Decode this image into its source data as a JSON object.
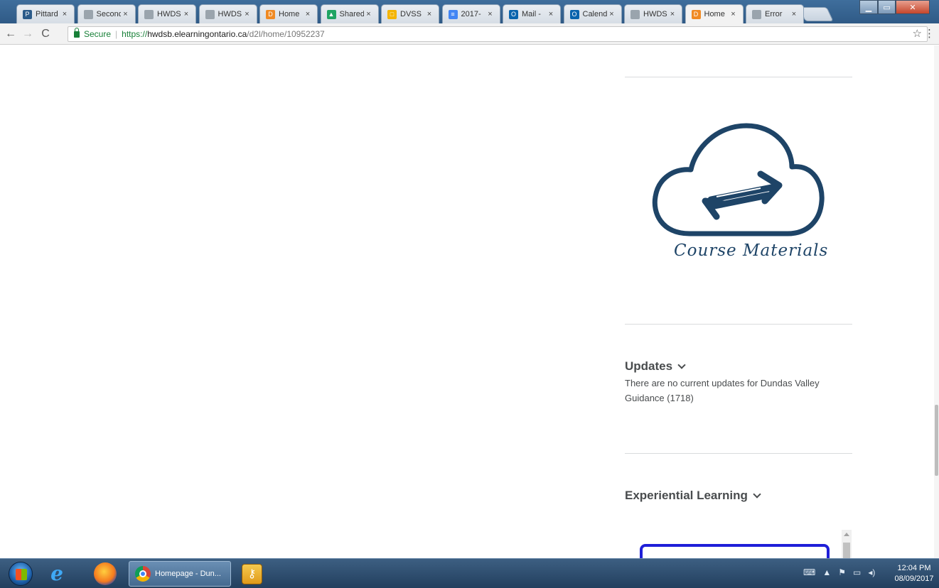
{
  "browser": {
    "tabs": [
      {
        "title": "Pittard",
        "favicon_color": "#2b5b8a",
        "favicon_char": "P"
      },
      {
        "title": "Second",
        "favicon_color": "#9aa4ad",
        "favicon_char": ""
      },
      {
        "title": "HWDS",
        "favicon_color": "#9aa4ad",
        "favicon_char": ""
      },
      {
        "title": "HWDS",
        "favicon_color": "#9aa4ad",
        "favicon_char": ""
      },
      {
        "title": "Home",
        "favicon_color": "#f08a24",
        "favicon_char": "D"
      },
      {
        "title": "Shared",
        "favicon_color": "#1fa463",
        "favicon_char": "▲"
      },
      {
        "title": "DVSS",
        "favicon_color": "#f4b400",
        "favicon_char": "□"
      },
      {
        "title": "2017-",
        "favicon_color": "#4285f4",
        "favicon_char": "≡"
      },
      {
        "title": "Mail -",
        "favicon_color": "#0a64ad",
        "favicon_char": "O"
      },
      {
        "title": "Calend",
        "favicon_color": "#0a64ad",
        "favicon_char": "O"
      },
      {
        "title": "HWDS",
        "favicon_color": "#9aa4ad",
        "favicon_char": ""
      },
      {
        "title": "Home",
        "favicon_color": "#f08a24",
        "favicon_char": "D",
        "active": true
      },
      {
        "title": "Error",
        "favicon_color": "#9aa4ad",
        "favicon_char": ""
      }
    ],
    "tab_close": "×",
    "address": {
      "secure_label": "Secure",
      "scheme": "https://",
      "host": "hwdsb.elearningontario.ca",
      "path": "/d2l/home/10952237"
    }
  },
  "page": {
    "course_materials_label": "Course Materials",
    "updates_heading": "Updates",
    "updates_text": "There are no current updates for Dundas Valley Guidance (1718)",
    "experiential_heading": "Experiential Learning"
  },
  "taskbar": {
    "chrome_task_label": "Homepage - Dun...",
    "clock_time": "12:04 PM",
    "clock_date": "08/09/2017"
  },
  "colors": {
    "brand_dark_blue": "#1e4467",
    "secure_green": "#188038",
    "frame_blue": "#1f1fd8"
  }
}
